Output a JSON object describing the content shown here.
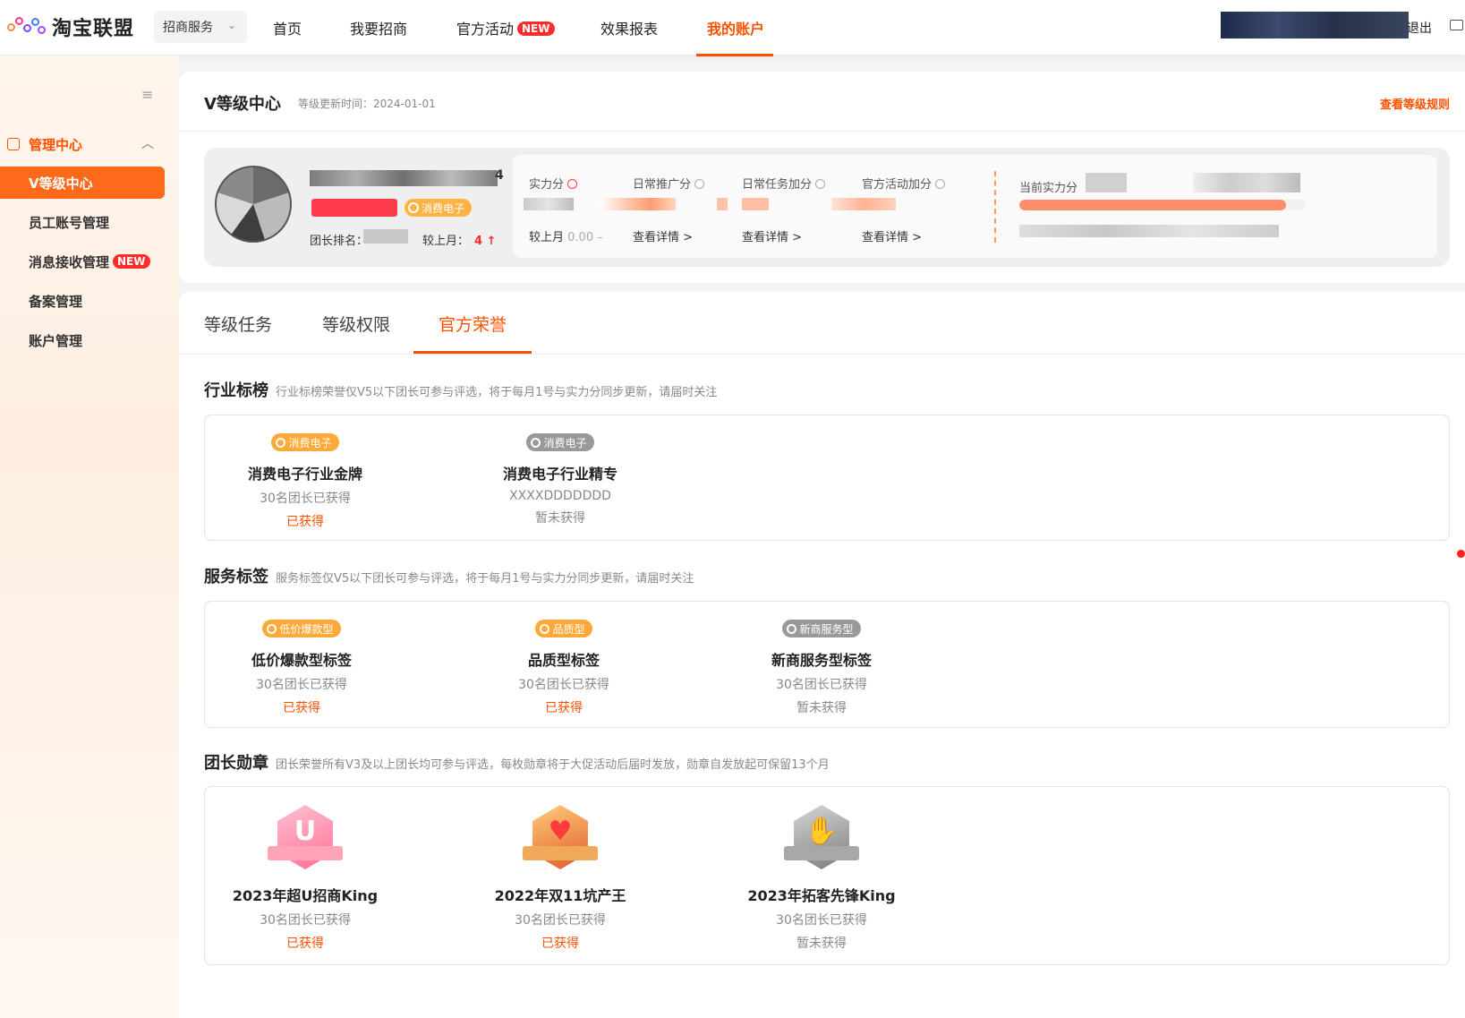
{
  "topbar": {
    "brand": "淘宝联盟",
    "service_select": "招商服务",
    "nav": [
      {
        "label": "首页"
      },
      {
        "label": "我要招商"
      },
      {
        "label": "官方活动",
        "badge": "NEW"
      },
      {
        "label": "效果报表"
      },
      {
        "label": "我的账户"
      }
    ],
    "logout": "退出"
  },
  "sidebar": {
    "group": "管理中心",
    "items": [
      {
        "label": "V等级中心"
      },
      {
        "label": "员工账号管理"
      },
      {
        "label": "消息接收管理",
        "badge": "NEW"
      },
      {
        "label": "备案管理"
      },
      {
        "label": "账户管理"
      }
    ]
  },
  "header": {
    "title": "V等级中心",
    "update_time": "等级更新时间：2024-01-01",
    "rules_link": "查看等级规则"
  },
  "profile": {
    "name_tail": "4",
    "tag": "消费电子",
    "rank_label": "团长排名：",
    "compare_label": "较上月：",
    "compare_value": "4",
    "scores": {
      "labels": [
        "实力分",
        "日常推广分",
        "日常任务加分",
        "官方活动加分"
      ],
      "compare_prefix": "较上月",
      "compare_value": "0.00",
      "detail_link": "查看详情 >"
    },
    "current_label": "当前实力分",
    "progress": 0.93
  },
  "tabs": [
    "等级任务",
    "等级权限",
    "官方荣誉"
  ],
  "sections": [
    {
      "title": "行业标榜",
      "desc": "行业标榜荣誉仅V5以下团长可参与评选，将于每月1号与实力分同步更新，请届时关注",
      "items": [
        {
          "pill": "消费电子",
          "pill_color": "orange",
          "name": "消费电子行业金牌",
          "count": "30名团长已获得",
          "status": "已获得",
          "got": true
        },
        {
          "pill": "消费电子",
          "pill_color": "grey",
          "name": "消费电子行业精专",
          "count": "XXXXDDDDDDD",
          "status": "暂未获得",
          "got": false
        }
      ]
    },
    {
      "title": "服务标签",
      "desc": "服务标签仅V5以下团长可参与评选，将于每月1号与实力分同步更新，请届时关注",
      "items": [
        {
          "pill": "低价爆款型",
          "pill_color": "orange",
          "name": "低价爆款型标签",
          "count": "30名团长已获得",
          "status": "已获得",
          "got": true
        },
        {
          "pill": "品质型",
          "pill_color": "orange",
          "name": "品质型标签",
          "count": "30名团长已获得",
          "status": "已获得",
          "got": true
        },
        {
          "pill": "新商服务型",
          "pill_color": "grey",
          "name": "新商服务型标签",
          "count": "30名团长已获得",
          "status": "暂未获得",
          "got": false
        }
      ]
    },
    {
      "title": "团长勋章",
      "desc": "团长荣誉所有V3及以上团长均可参与评选，每枚勋章将于大促活动后届时发放，勋章自发放起可保留13个月",
      "items": [
        {
          "name": "2023年超U招商King",
          "count": "30名团长已获得",
          "status": "已获得",
          "got": true,
          "medal": "pink",
          "symbol": "U"
        },
        {
          "name": "2022年双11坑产王",
          "count": "30名团长已获得",
          "status": "已获得",
          "got": true,
          "medal": "gold",
          "symbol": "♥"
        },
        {
          "name": "2023年拓客先锋King",
          "count": "30名团长已获得",
          "status": "暂未获得",
          "got": false,
          "medal": "grey",
          "symbol": "✋"
        }
      ]
    }
  ]
}
